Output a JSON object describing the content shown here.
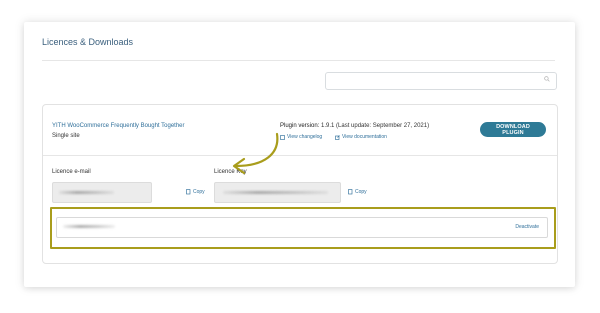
{
  "page": {
    "title": "Licences & Downloads"
  },
  "search": {
    "placeholder": "",
    "icon": "search-icon"
  },
  "plugin": {
    "name": "YITH WooCommerce Frequently Bought Together",
    "site_type": "Single site",
    "version_label": "Plugin version:",
    "version_value": "1.9.1 (Last update: September 27, 2021)",
    "changelog_link": "View changelog",
    "documentation_link": "View documentation",
    "download_button": "DOWNLOAD PLUGIN"
  },
  "licence": {
    "email_label": "Licence e-mail",
    "key_label": "Licence Key",
    "copy_label": "Copy",
    "deactivate_label": "Deactivate"
  },
  "colors": {
    "accent": "#2e7a96",
    "link": "#2f6f9a",
    "highlight": "#a99d1c"
  }
}
